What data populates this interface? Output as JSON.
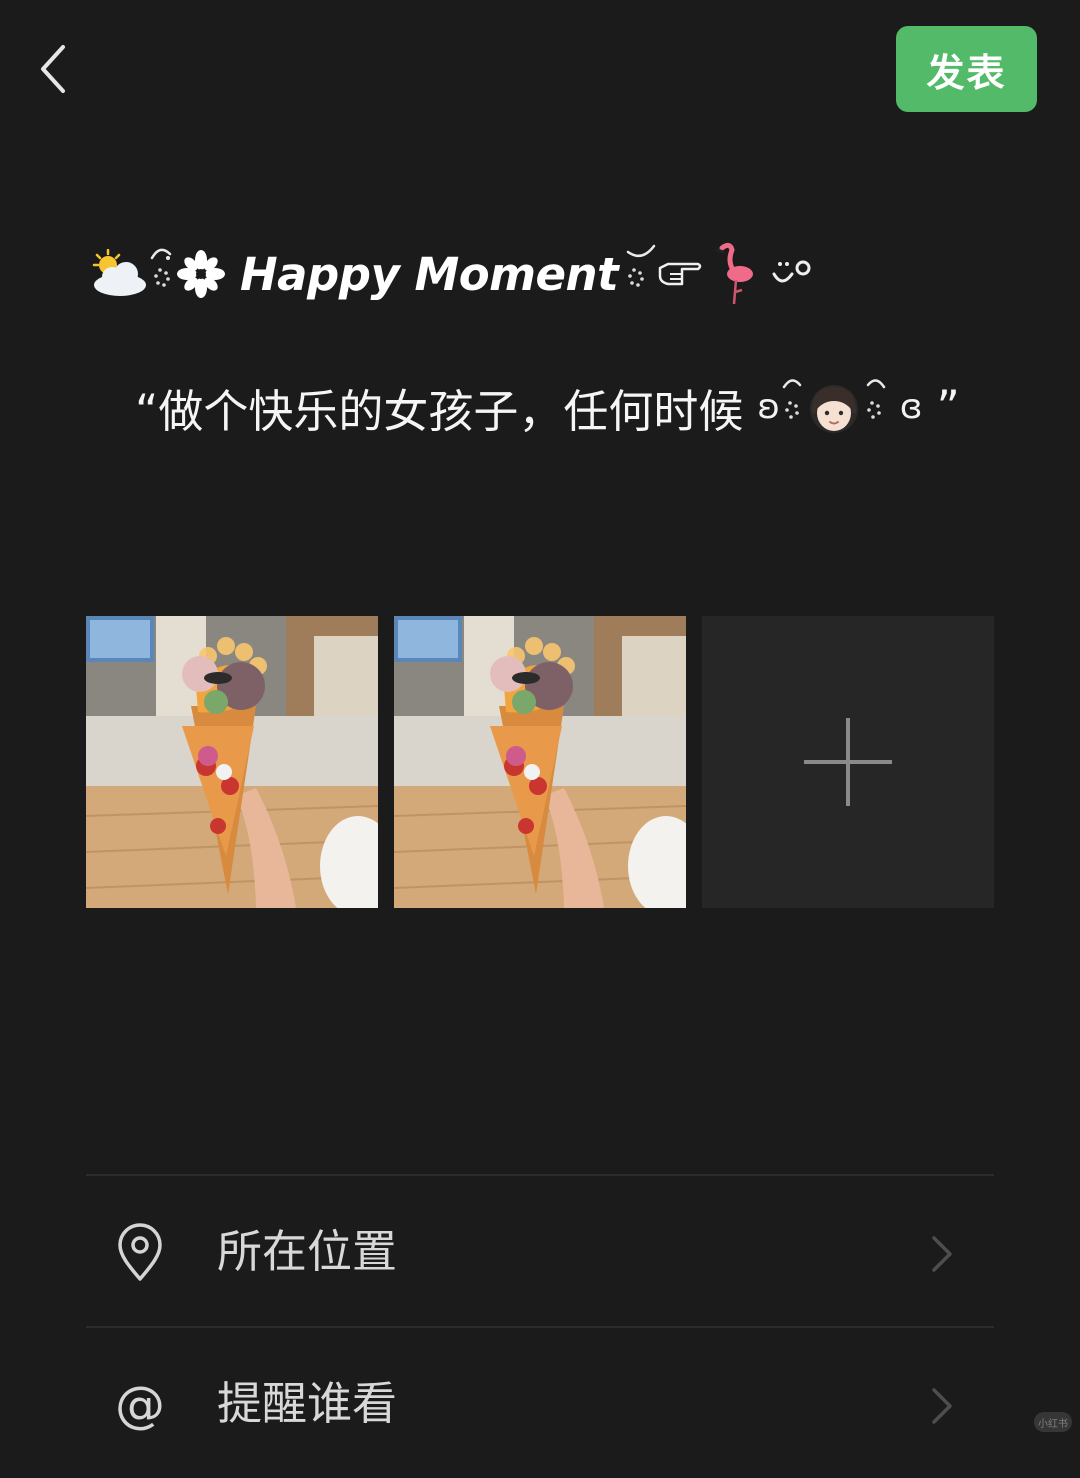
{
  "header": {
    "publish_label": "发表"
  },
  "post": {
    "title_text": "Happy Moment",
    "title_icons": [
      "sun-behind-cloud-icon",
      "sparkle-flower-icon",
      "pointing-hand-icon",
      "flamingo-icon"
    ],
    "quote_text": "“做个快乐的女孩子，任何时候",
    "quote_decor_left": "ʚ",
    "quote_decor_right": "ɞ",
    "quote_close": "”",
    "quote_icons": [
      "girl-face-icon"
    ]
  },
  "photos": [
    {
      "description": "ice-cream-cone-photo"
    },
    {
      "description": "ice-cream-cone-photo"
    }
  ],
  "options": [
    {
      "label": "所在位置",
      "icon": "location-pin-icon"
    },
    {
      "label": "提醒谁看",
      "icon": "at-icon",
      "glyph": "@"
    }
  ],
  "watermark": "小红书",
  "colors": {
    "background": "#1b1b1b",
    "publish_button": "#52ba68",
    "add_tile": "#262626"
  }
}
